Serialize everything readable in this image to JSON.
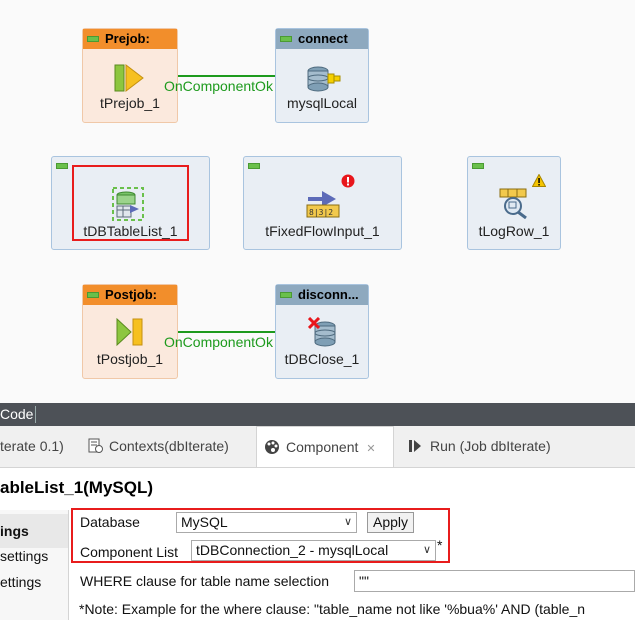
{
  "canvas": {
    "nodes": {
      "prejob": {
        "header": "Prejob:",
        "label": "tPrejob_1"
      },
      "connect": {
        "header": "connect",
        "label": "mysqlLocal"
      },
      "tablelist": {
        "label": "tDBTableList_1"
      },
      "fixedflow": {
        "label": "tFixedFlowInput_1"
      },
      "logrow": {
        "label": "tLogRow_1"
      },
      "postjob": {
        "header": "Postjob:",
        "label": "tPostjob_1"
      },
      "disconnect": {
        "header": "disconn...",
        "label": "tDBClose_1"
      }
    },
    "links": {
      "top": "OnComponentOk",
      "bottom": "OnComponentOk"
    }
  },
  "code_tab": "Code",
  "tabs": {
    "iterate": "terate 0.1)",
    "contexts": "Contexts(dbIterate)",
    "component": "Component",
    "run": "Run (Job dbIterate)"
  },
  "component_title": "ableList_1(MySQL)",
  "nav": {
    "basic": "ings",
    "advanced": "settings",
    "dynamic": "ettings"
  },
  "form": {
    "database_label": "Database",
    "database_value": "MySQL",
    "apply_label": "Apply",
    "component_list_label": "Component List",
    "component_list_value": "tDBConnection_2 - mysqlLocal",
    "required_marker": "*",
    "where_label": "WHERE clause for table name selection",
    "where_value": "\"\"",
    "note": "*Note: Example for the where clause: \"table_name not like '%bua%' AND (table_n"
  },
  "colors": {
    "selection": "#e81c1c",
    "link": "#1d9a1d",
    "orange_header": "#f28e2b"
  }
}
